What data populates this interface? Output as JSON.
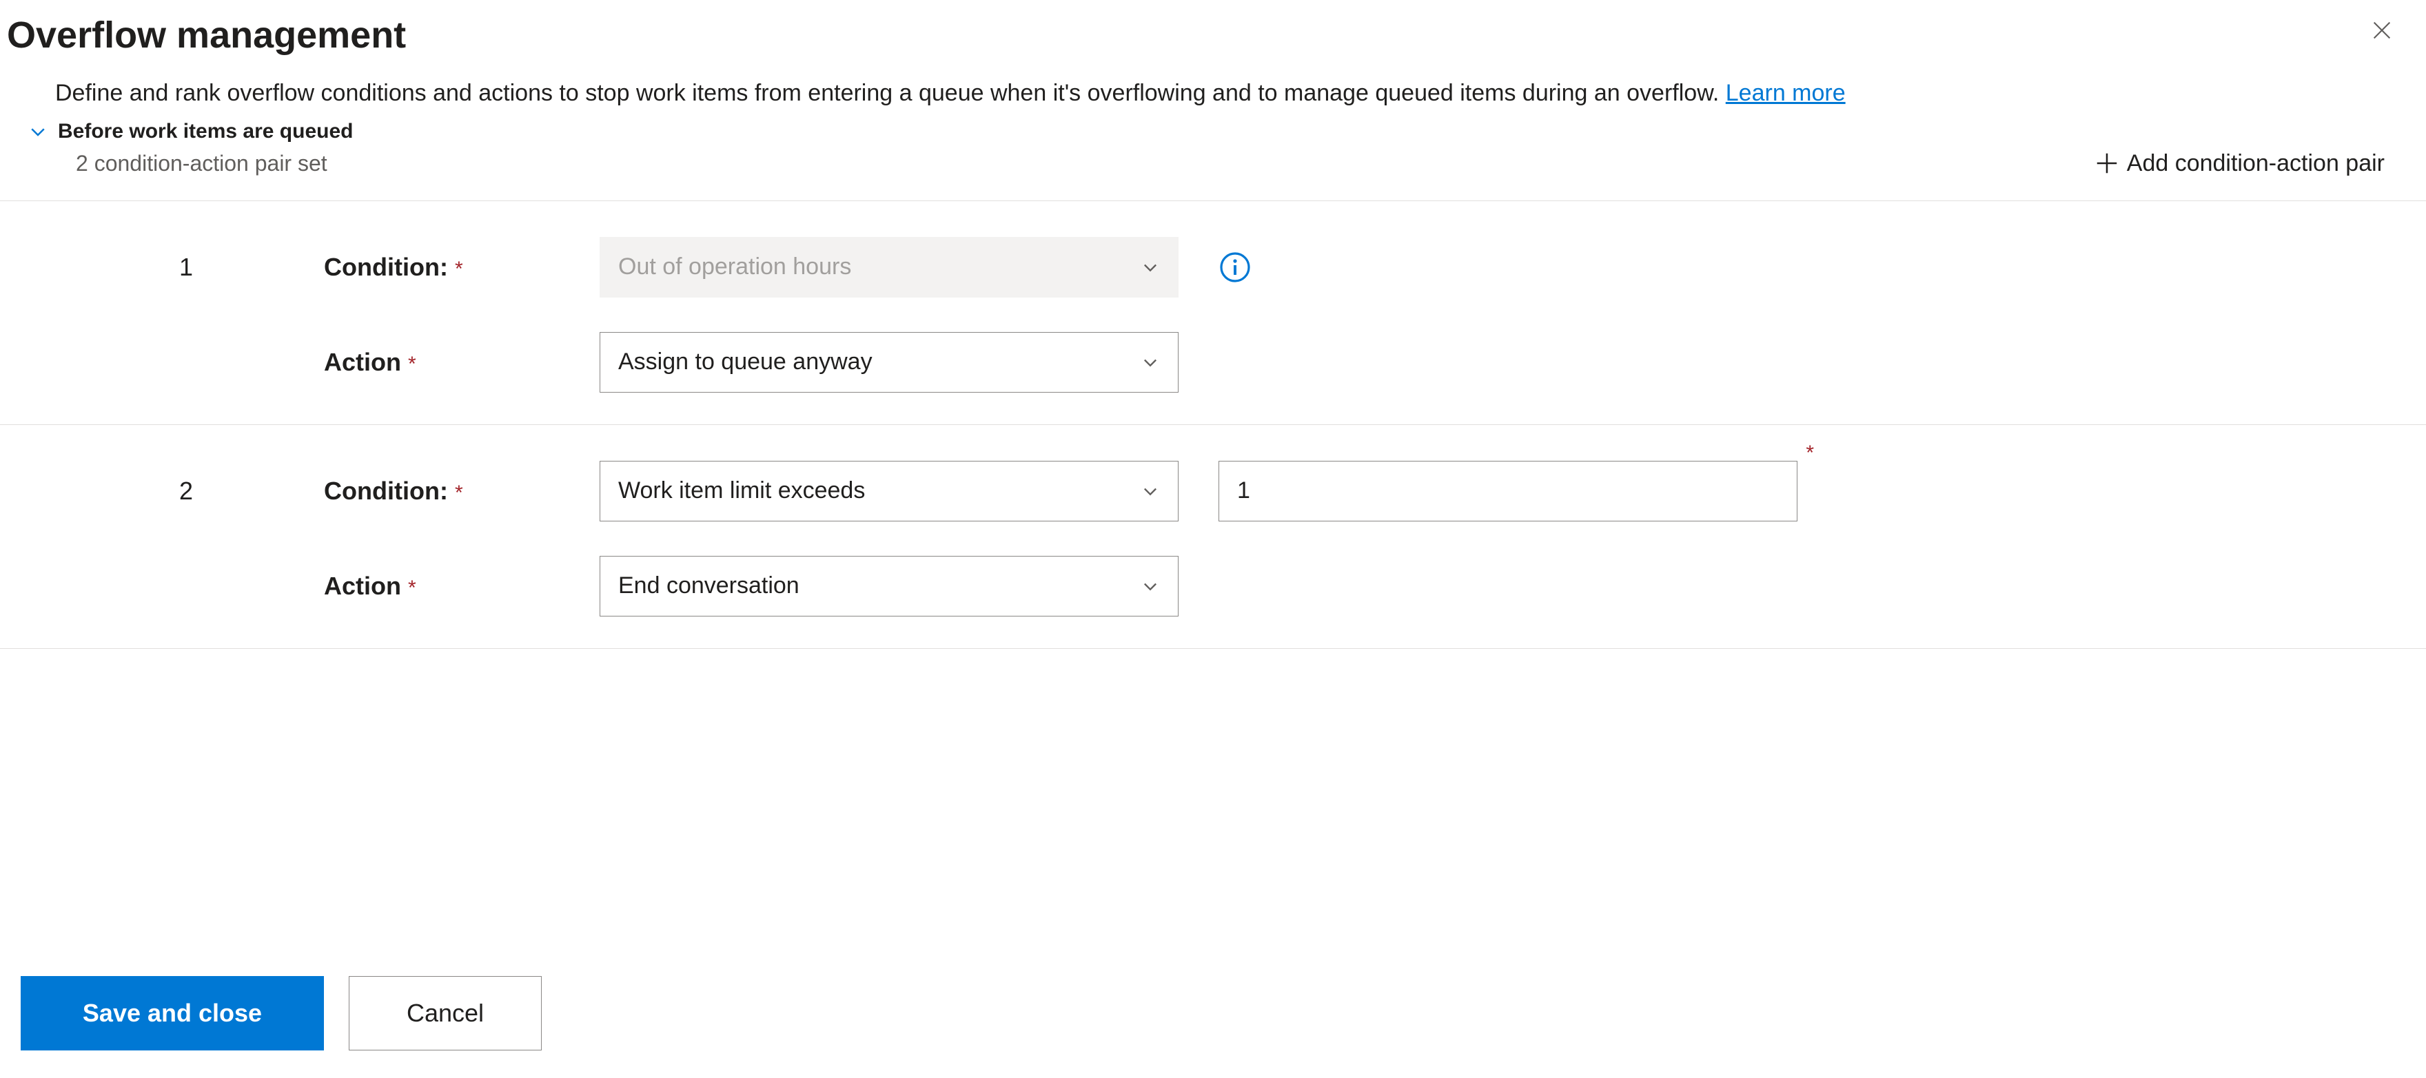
{
  "title": "Overflow management",
  "description": "Define and rank overflow conditions and actions to stop work items from entering a queue when it's overflowing and to manage queued items during an overflow. ",
  "learn_more": "Learn more",
  "section": {
    "title": "Before work items are queued",
    "count_text": "2 condition-action pair set",
    "add_label": "Add condition-action pair"
  },
  "labels": {
    "condition": "Condition:",
    "action": "Action"
  },
  "pairs": [
    {
      "index": "1",
      "condition_value": "Out of operation hours",
      "condition_disabled": true,
      "has_info": true,
      "has_numeric": false,
      "numeric_value": "",
      "action_value": "Assign to queue anyway"
    },
    {
      "index": "2",
      "condition_value": "Work item limit exceeds",
      "condition_disabled": false,
      "has_info": false,
      "has_numeric": true,
      "numeric_value": "1",
      "action_value": "End conversation"
    }
  ],
  "footer": {
    "save": "Save and close",
    "cancel": "Cancel"
  }
}
